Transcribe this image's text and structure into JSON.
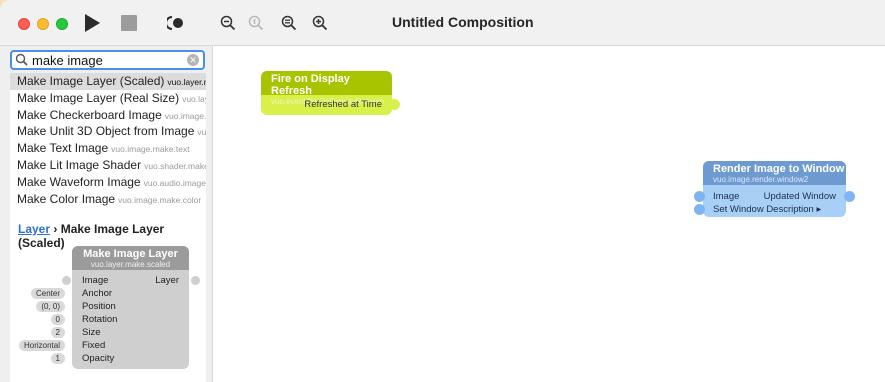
{
  "window": {
    "title": "Untitled Composition"
  },
  "search": {
    "query": "make image"
  },
  "results": [
    {
      "name": "Make Image Layer (Scaled)",
      "class": "vuo.layer.make.scaled",
      "selected": true
    },
    {
      "name": "Make Image Layer (Real Size)",
      "class": "vuo.layer.make.realSize",
      "selected": false
    },
    {
      "name": "Make Checkerboard Image",
      "class": "vuo.image.make.checkerboard",
      "selected": false
    },
    {
      "name": "Make Unlit 3D Object from Image",
      "class": "vuo.scene.make.image.unlit",
      "selected": false
    },
    {
      "name": "Make Text Image",
      "class": "vuo.image.make.text",
      "selected": false
    },
    {
      "name": "Make Lit Image Shader",
      "class": "vuo.shader.make.image",
      "selected": false
    },
    {
      "name": "Make Waveform Image",
      "class": "vuo.audio.image.waveform",
      "selected": false
    },
    {
      "name": "Make Color Image",
      "class": "vuo.image.make.color",
      "selected": false
    }
  ],
  "detail": {
    "breadcrumb_link": "Layer",
    "breadcrumb_sep": " › ",
    "breadcrumb_title": "Make Image Layer (Scaled)",
    "node": {
      "title": "Make Image Layer",
      "class": "vuo.layer.make.scaled",
      "output": "Layer",
      "inputs": [
        {
          "label": "Image",
          "value": ""
        },
        {
          "label": "Anchor",
          "value": "Center"
        },
        {
          "label": "Position",
          "value": "(0, 0)"
        },
        {
          "label": "Rotation",
          "value": "0"
        },
        {
          "label": "Size",
          "value": "2"
        },
        {
          "label": "Fixed",
          "value": "Horizontal"
        },
        {
          "label": "Opacity",
          "value": "1"
        }
      ]
    }
  },
  "canvas": {
    "fire_node": {
      "title": "Fire on Display Refresh",
      "class": "vuo.event.fireOnDisplayRefresh",
      "output": "Refreshed at Time"
    },
    "render_node": {
      "title": "Render Image to Window",
      "class": "vuo.image.render.window2",
      "input_image": "Image",
      "output_window": "Updated Window",
      "input_description": "Set Window Description ▸"
    }
  },
  "colors": {
    "fire_header": "#a8c400",
    "fire_body": "#d9f04a",
    "render_header": "#6e9ad2",
    "render_body": "#a8cff5",
    "search_focus": "#4a8ef0"
  }
}
